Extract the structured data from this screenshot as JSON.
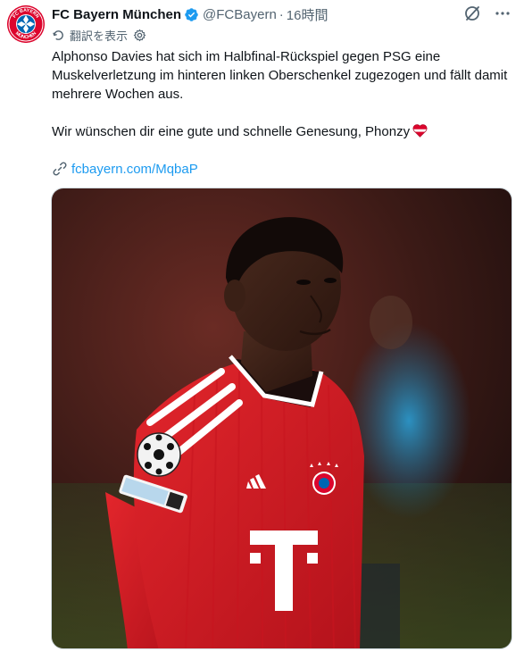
{
  "tweet": {
    "author_name": "FC Bayern München",
    "handle": "@FCBayern",
    "separator": "·",
    "time": "16時間",
    "translate_label": "翻訳を表示",
    "paragraph_1": "Alphonso Davies hat sich im Halbfinal-Rückspiel gegen PSG eine Muskelverletzung im hinteren linken Oberschenkel zugezogen und fällt damit mehrere Wochen aus.",
    "paragraph_2": "Wir wünschen dir eine gute und schnelle Genesung, Phonzy",
    "link": "fcbayern.com/MqbaP",
    "avatar_logo_text_top": "FC BAYERN",
    "avatar_logo_text_bottom": "MÜNCHEN",
    "media_alt": "Alphonso Davies im roten FC-Bayern-Trikot"
  },
  "icons": {
    "verified": "verified-badge-icon",
    "grok": "grok-icon",
    "more": "more-options-icon",
    "translate": "translate-icon",
    "settings": "settings-gear-icon",
    "heart": "red-white-heart-emoji",
    "link": "link-icon"
  },
  "colors": {
    "accent": "#1d9bf0",
    "text": "#0f1419",
    "secondary": "#536471",
    "bayern_red": "#dc052d"
  }
}
